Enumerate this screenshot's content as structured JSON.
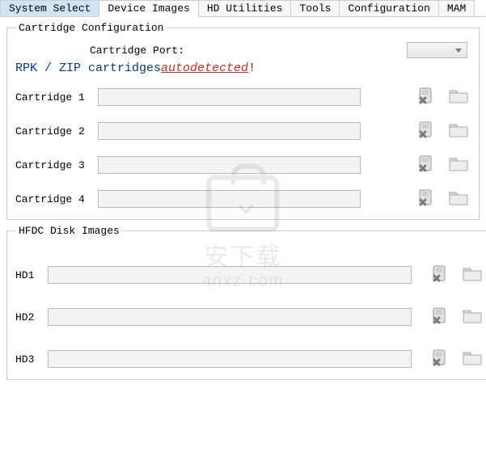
{
  "tabs": {
    "t0": "System Select",
    "t1": "Device Images",
    "t2": "HD Utilities",
    "t3": "Tools",
    "t4": "Configuration",
    "t5": "MAM"
  },
  "cartridge": {
    "legend": "Cartridge Configuration",
    "port_label": "Cartridge Port:",
    "port_value": "",
    "notice_prefix": "RPK / ZIP cartridges",
    "notice_detected": "autodetected",
    "notice_suffix": "!",
    "rows": {
      "c1": {
        "label": "Cartridge 1",
        "value": ""
      },
      "c2": {
        "label": "Cartridge 2",
        "value": ""
      },
      "c3": {
        "label": "Cartridge 3",
        "value": ""
      },
      "c4": {
        "label": "Cartridge 4",
        "value": ""
      }
    }
  },
  "hfdc": {
    "legend": "HFDC Disk Images",
    "rows": {
      "h1": {
        "label": "HD1",
        "value": ""
      },
      "h2": {
        "label": "HD2",
        "value": ""
      },
      "h3": {
        "label": "HD3",
        "value": ""
      }
    }
  },
  "watermark": {
    "zh": "安下载",
    "en": "anxz.com"
  }
}
